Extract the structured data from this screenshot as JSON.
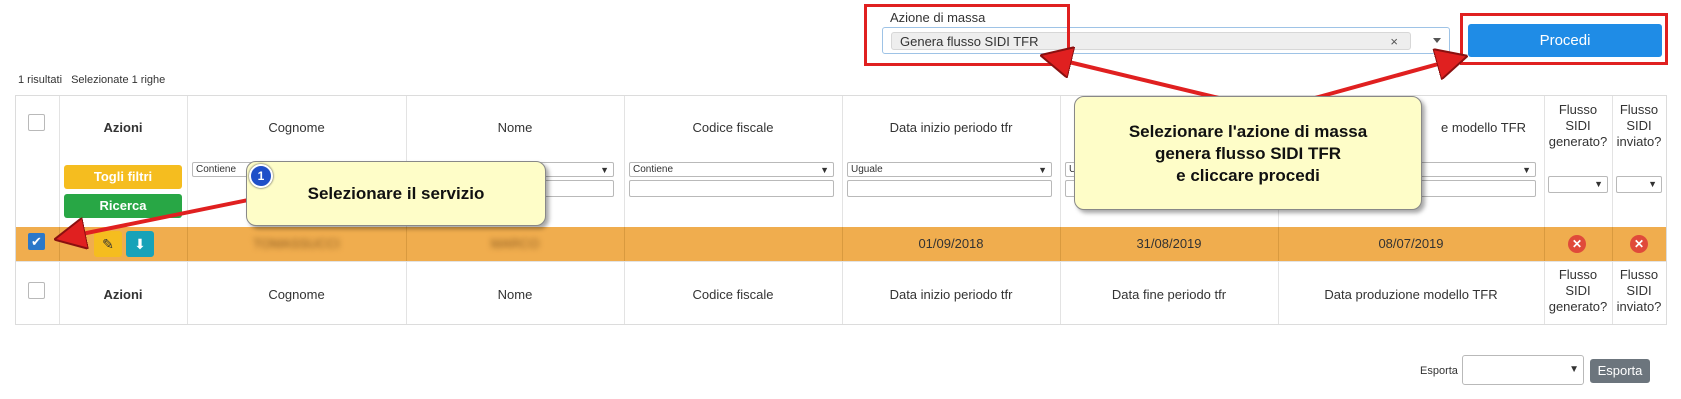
{
  "mass_action": {
    "label": "Azione di massa",
    "selected": "Genera flusso SIDI TFR",
    "clear": "×",
    "proceed_label": "Procedi"
  },
  "results": {
    "count": "1 risultati",
    "selected": "Selezionate 1 righe"
  },
  "columns": [
    "Azioni",
    "Cognome",
    "Nome",
    "Codice fiscale",
    "Data inizio periodo tfr",
    "Data fine periodo tfr",
    "Data produzione modello TFR",
    "Flusso SIDI generato?",
    "Flusso SIDI inviato?"
  ],
  "header_visible": {
    "data_produzione_partial": "e modello TFR",
    "flusso_generato": [
      "Flusso",
      "SIDI",
      "generato?"
    ],
    "flusso_inviato": [
      "Flusso",
      "SIDI",
      "inviato?"
    ]
  },
  "filters": {
    "cognome_mode": "Contiene",
    "codice_fiscale_mode": "Contiene",
    "data_inizio_mode": "Uguale",
    "data_fine_mode": "U"
  },
  "buttons": {
    "togli_filtri": "Togli filtri",
    "ricerca": "Ricerca"
  },
  "row": {
    "cognome": "TOMASSUCCI",
    "nome": "MARCO",
    "codice_fiscale": "",
    "data_inizio": "01/09/2018",
    "data_fine": "31/08/2019",
    "data_produzione": "08/07/2019"
  },
  "callouts": {
    "servizio": "Selezionare il servizio",
    "badge": "1",
    "azione_line1": "Selezionare l'azione di massa",
    "azione_line2": "genera flusso SIDI  TFR",
    "azione_line3": "e cliccare procedi"
  },
  "export": {
    "label": "Esporta",
    "button": "Esporta"
  },
  "colors": {
    "primary": "#1f8ce6",
    "warning": "#f5bd1f",
    "success": "#28a745",
    "selected_row": "#f0ad4e",
    "danger": "#e04a3a",
    "annotation_red": "#e02020"
  }
}
